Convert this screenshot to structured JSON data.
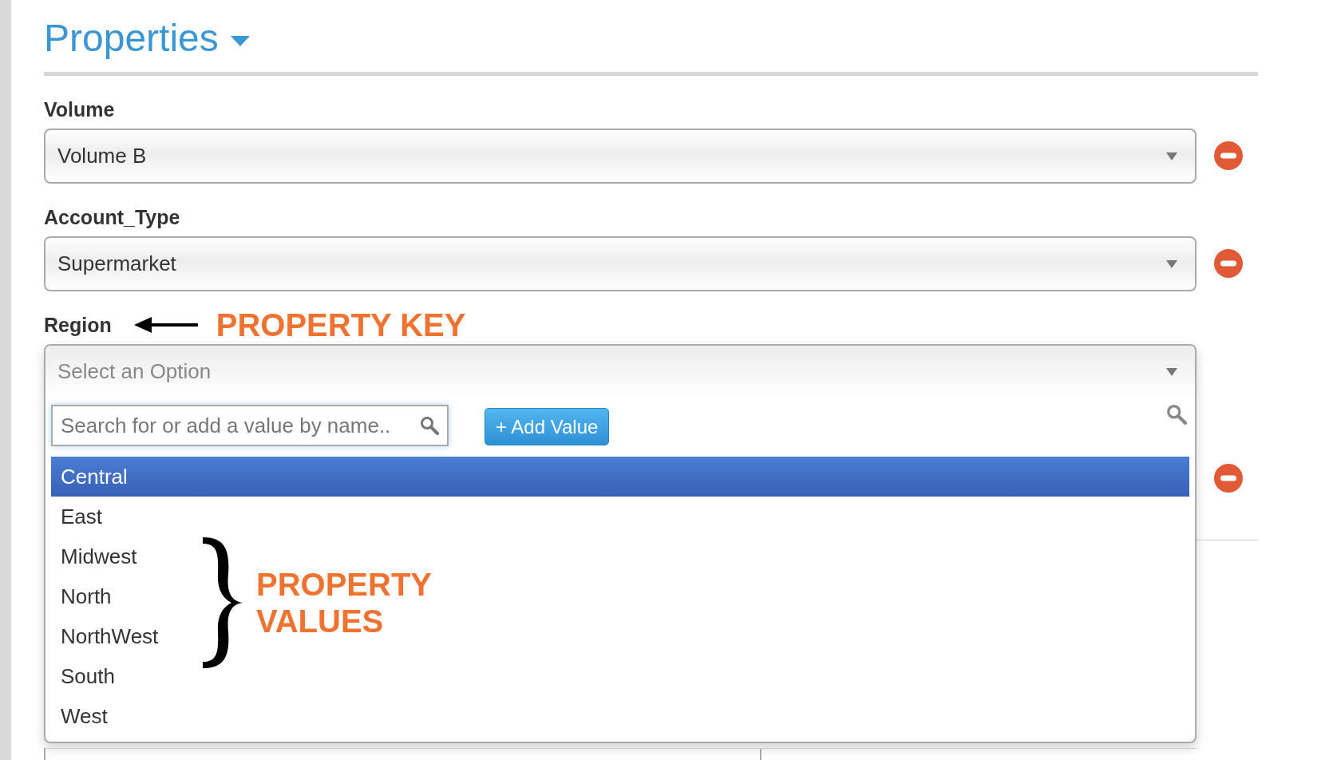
{
  "header": {
    "title": "Properties"
  },
  "properties": [
    {
      "label": "Volume",
      "value": "Volume B",
      "open": false
    },
    {
      "label": "Account_Type",
      "value": "Supermarket",
      "open": false
    },
    {
      "label": "Region",
      "placeholder": "Select an Option",
      "open": true,
      "search": {
        "placeholder": "Search for or add a value by name.."
      },
      "add_button": "+ Add Value",
      "options": [
        {
          "label": "Central",
          "selected": true
        },
        {
          "label": "East",
          "selected": false
        },
        {
          "label": "Midwest",
          "selected": false
        },
        {
          "label": "North",
          "selected": false
        },
        {
          "label": "NorthWest",
          "selected": false
        },
        {
          "label": "South",
          "selected": false
        },
        {
          "label": "West",
          "selected": false
        }
      ]
    }
  ],
  "annotations": {
    "key_label": "PROPERTY KEY",
    "values_label": "PROPERTY VALUES"
  }
}
